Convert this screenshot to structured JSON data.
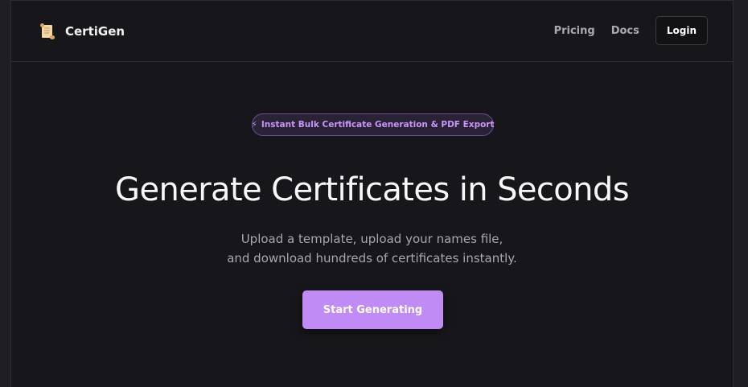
{
  "nav": {
    "brand_name": "CertiGen",
    "links": [
      "Pricing",
      "Docs"
    ],
    "login_label": "Login"
  },
  "hero": {
    "badge_icon": "⚡",
    "badge_text": "Instant Bulk Certificate Generation & PDF Export",
    "headline": "Generate Certificates in Seconds",
    "subtitle_line1": "Upload a template, upload your names file,",
    "subtitle_line2": "and download hundreds of certificates instantly.",
    "cta_label": "Start Generating"
  },
  "colors": {
    "accent": "#c18bf6",
    "badge_text": "#c796f6",
    "background": "#17171b"
  },
  "icons": {
    "brand": "scroll-icon",
    "badge": "lightning-icon"
  }
}
